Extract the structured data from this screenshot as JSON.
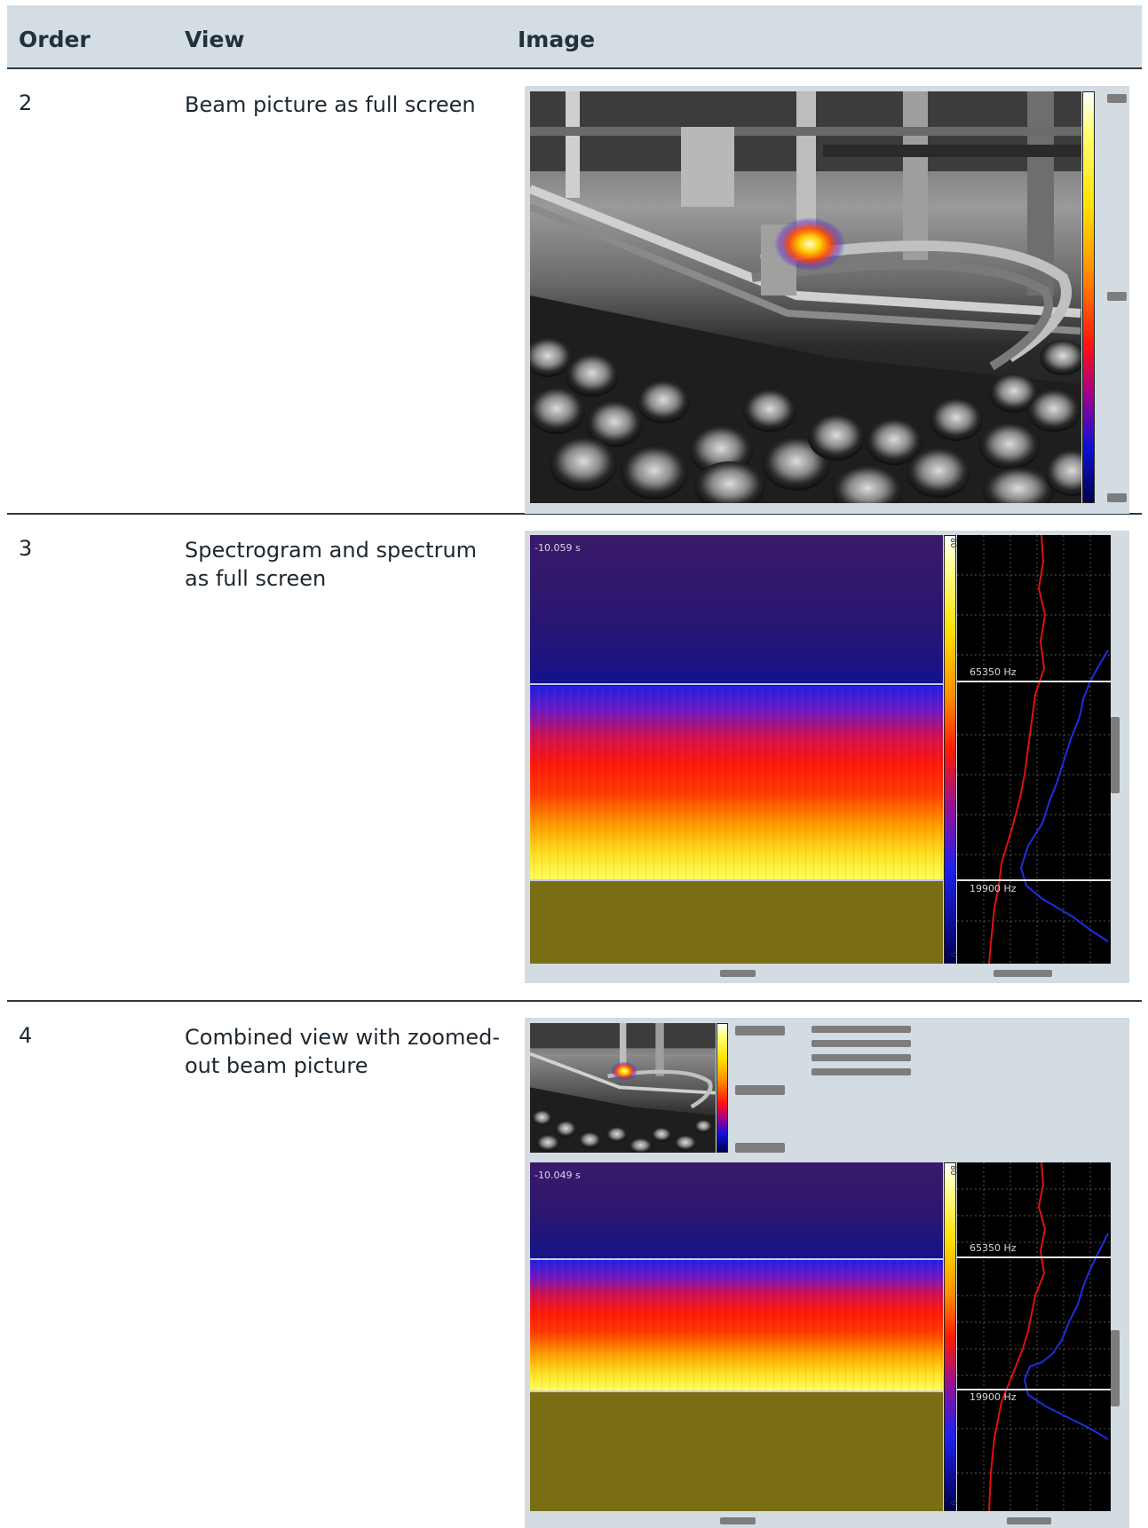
{
  "table": {
    "headers": {
      "order": "Order",
      "view": "View",
      "image": "Image"
    },
    "rows": [
      {
        "order": "2",
        "view": "Beam picture as full screen"
      },
      {
        "order": "3",
        "view": "Spectrogram and spectrum as full screen",
        "spectrogram_time": "-10.059 s",
        "hz_upper": "65350 Hz",
        "hz_lower": "19900 Hz",
        "colorbar_top": "80",
        "colorbar_bottom": "0"
      },
      {
        "order": "4",
        "view": "Combined view with zoomed-out beam picture",
        "spectrogram_time": "-10.049 s",
        "hz_upper": "65350 Hz",
        "hz_lower": "19900 Hz",
        "colorbar_top": "80",
        "colorbar_bottom": "0"
      }
    ]
  },
  "colors": {
    "header_bg": "#d3dde3",
    "panel_bg": "#d2dce2",
    "rule": "#2b3a44",
    "spectrum_red": "#e01010",
    "spectrum_blue": "#1e2ee0"
  }
}
